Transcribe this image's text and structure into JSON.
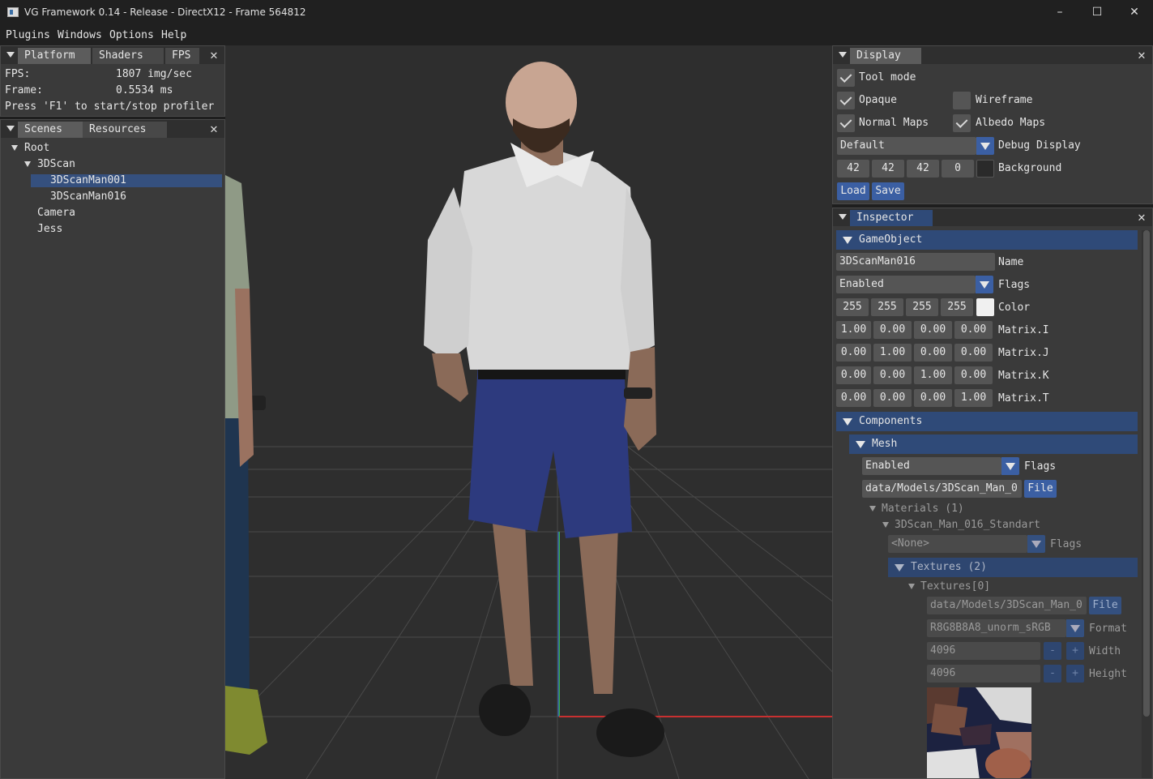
{
  "window": {
    "title": "VG Framework 0.14 - Release - DirectX12 - Frame 564812",
    "minimize": "–",
    "maximize": "☐",
    "close": "✕"
  },
  "menu": [
    "Plugins",
    "Windows",
    "Options",
    "Help"
  ],
  "fps_panel": {
    "tabs": [
      "Platform",
      "Shaders",
      "FPS"
    ],
    "fps_label": "FPS:",
    "fps_value": "1807 img/sec",
    "frame_label": "Frame:",
    "frame_value": "0.5534 ms",
    "hint": "Press 'F1' to start/stop profiler"
  },
  "scenes_panel": {
    "tabs": [
      "Scenes",
      "Resources"
    ],
    "tree": {
      "root": "Root",
      "scan": "3DScan",
      "man001": "3DScanMan001",
      "man016": "3DScanMan016",
      "camera": "Camera",
      "jess": "Jess"
    }
  },
  "display_panel": {
    "title": "Display",
    "tool_mode": "Tool mode",
    "opaque": "Opaque",
    "wireframe": "Wireframe",
    "normal_maps": "Normal Maps",
    "albedo_maps": "Albedo Maps",
    "debug_display_value": "Default",
    "debug_display_label": "Debug Display",
    "bg_r": "42",
    "bg_g": "42",
    "bg_b": "42",
    "bg_a": "0",
    "background_label": "Background",
    "load": "Load",
    "save": "Save",
    "background_color": "#2a2a2a"
  },
  "inspector": {
    "title": "Inspector",
    "gameobject_header": "GameObject",
    "name_value": "3DScanMan016",
    "name_label": "Name",
    "flags_value": "Enabled",
    "flags_label": "Flags",
    "color": [
      "255",
      "255",
      "255",
      "255"
    ],
    "color_label": "Color",
    "matrix": {
      "i": [
        "1.00",
        "0.00",
        "0.00",
        "0.00"
      ],
      "j": [
        "0.00",
        "1.00",
        "0.00",
        "0.00"
      ],
      "k": [
        "0.00",
        "0.00",
        "1.00",
        "0.00"
      ],
      "t": [
        "0.00",
        "0.00",
        "0.00",
        "1.00"
      ]
    },
    "matrix_labels": [
      "Matrix.I",
      "Matrix.J",
      "Matrix.K",
      "Matrix.T"
    ],
    "components_header": "Components",
    "mesh_header": "Mesh",
    "mesh_flags_value": "Enabled",
    "mesh_flags_label": "Flags",
    "mesh_file_value": "data/Models/3DScan_Man_0",
    "file_button": "File",
    "materials_label": "Materials (1)",
    "material_name": "3DScan_Man_016_Standart",
    "material_flags_value": "<None>",
    "material_flags_label": "Flags",
    "textures_header": "Textures (2)",
    "texture0_label": "Textures[0]",
    "texture_file_value": "data/Models/3DScan_Man_0",
    "texture_file_button": "File",
    "format_value": "R8G8B8A8_unorm_sRGB",
    "format_label": "Format",
    "width_value": "4096",
    "width_label": "Width",
    "height_value": "4096",
    "height_label": "Height",
    "minus": "-",
    "plus": "+"
  }
}
